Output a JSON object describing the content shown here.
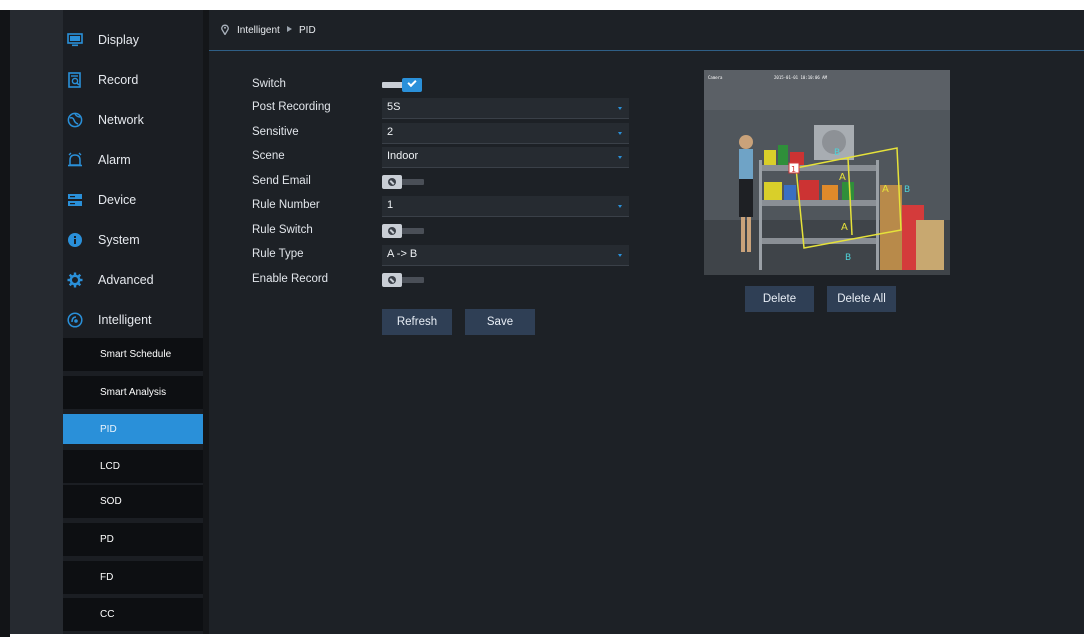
{
  "sidebar": {
    "items": [
      {
        "label": "Display",
        "icon": "monitor-icon"
      },
      {
        "label": "Record",
        "icon": "record-search-icon"
      },
      {
        "label": "Network",
        "icon": "globe-icon"
      },
      {
        "label": "Alarm",
        "icon": "alarm-bell-icon"
      },
      {
        "label": "Device",
        "icon": "storage-device-icon"
      },
      {
        "label": "System",
        "icon": "info-icon"
      },
      {
        "label": "Advanced",
        "icon": "gear-icon"
      },
      {
        "label": "Intelligent",
        "icon": "intelligent-icon"
      }
    ],
    "subitems": [
      {
        "label": "Smart Schedule"
      },
      {
        "label": "Smart Analysis"
      },
      {
        "label": "PID",
        "active": true
      },
      {
        "label": "LCD"
      },
      {
        "label": "SOD"
      },
      {
        "label": "PD"
      },
      {
        "label": "FD"
      },
      {
        "label": "CC"
      }
    ]
  },
  "breadcrumb": {
    "section": "Intelligent",
    "page": "PID"
  },
  "form": {
    "switch": {
      "label": "Switch",
      "on": true
    },
    "post_recording": {
      "label": "Post Recording",
      "value": "5S"
    },
    "sensitive": {
      "label": "Sensitive",
      "value": "2"
    },
    "scene": {
      "label": "Scene",
      "value": "Indoor"
    },
    "send_email": {
      "label": "Send Email",
      "on": false
    },
    "rule_number": {
      "label": "Rule Number",
      "value": "1"
    },
    "rule_switch": {
      "label": "Rule Switch",
      "on": false
    },
    "rule_type": {
      "label": "Rule Type",
      "value": "A -> B"
    },
    "enable_record": {
      "label": "Enable Record",
      "on": false
    }
  },
  "buttons": {
    "refresh": "Refresh",
    "save": "Save",
    "delete": "Delete",
    "delete_all": "Delete All"
  },
  "video": {
    "rule_marker": "1",
    "zone_labels": [
      "A",
      "A",
      "A",
      "B",
      "B",
      "B"
    ]
  },
  "colors": {
    "accent": "#2a90d9",
    "rule_line": "#e6e23a",
    "sidebar_bg": "#1b1e23",
    "main_bg": "#1d2126"
  }
}
